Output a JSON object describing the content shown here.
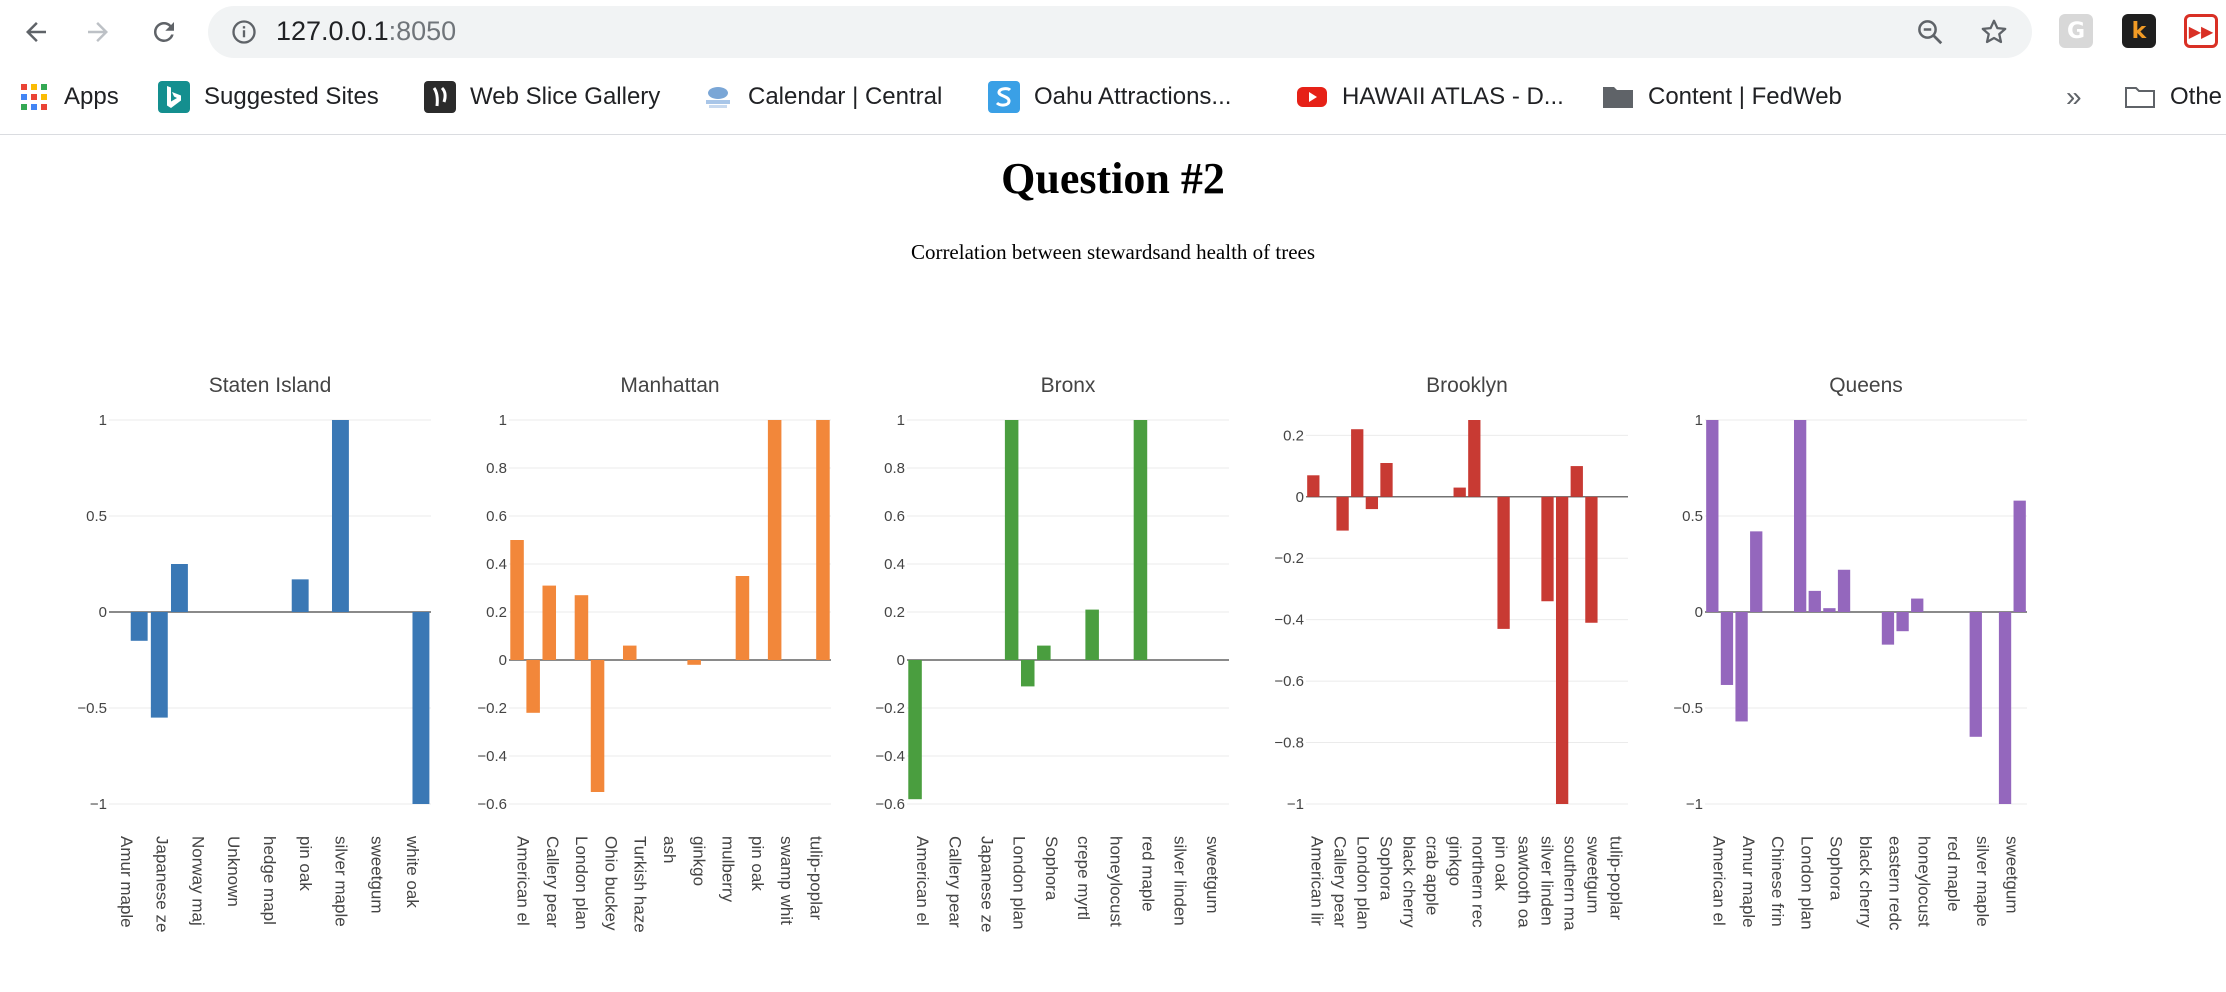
{
  "browser": {
    "url_host": "127.0.0.1",
    "url_port": ":8050"
  },
  "bookmarks": [
    {
      "label": "Apps",
      "icon": "apps-grid-icon"
    },
    {
      "label": "Suggested Sites",
      "icon": "bing-icon"
    },
    {
      "label": "Web Slice Gallery",
      "icon": "web-slice-icon"
    },
    {
      "label": "Calendar | Central",
      "icon": "calendar-logo-icon"
    },
    {
      "label": "Oahu Attractions...",
      "icon": "s-logo-icon"
    },
    {
      "label": "HAWAII ATLAS - D...",
      "icon": "youtube-icon"
    },
    {
      "label": "Content | FedWeb",
      "icon": "folder-icon"
    },
    {
      "label": "Othe",
      "icon": "folder-icon"
    }
  ],
  "page": {
    "title": "Question #2",
    "subtitle": "Correlation between stewardsand health of trees"
  },
  "colors": {
    "staten_island": "#3a78b5",
    "manhattan": "#f2873a",
    "bronx": "#4a9e3f",
    "brooklyn": "#c83a33",
    "queens": "#9467bd"
  },
  "chart_data": [
    {
      "type": "bar",
      "title": "Staten Island",
      "color": "#3a78b5",
      "categories": [
        "Amur maple",
        "Japanese ze",
        "Norway maple",
        "Unknown",
        "hedge maple",
        "pin oak",
        "silver maple",
        "sweetgum",
        "white oak"
      ],
      "tick_labels": [
        "Amur maple",
        "Japanese ze",
        "Norway maj",
        "Unknown",
        "hedge mapl",
        "pin oak",
        "silver maple",
        "sweetgum",
        "white oak"
      ],
      "values": [
        -0.15,
        -0.55,
        0.25,
        0,
        0,
        0.17,
        1,
        0,
        -1
      ],
      "ylim": [
        -1,
        1
      ],
      "yticks": [
        1,
        0.5,
        0,
        -0.5,
        -1
      ],
      "ytick_labels": [
        "1",
        "0.5",
        "0",
        "−0.5",
        "−1"
      ],
      "bar_slots": [
        [
          null,
          -0.15
        ],
        [
          -0.55,
          0.25
        ],
        [
          null,
          null
        ],
        [
          null,
          null
        ],
        [
          null,
          0.17
        ],
        [
          null,
          1
        ],
        [
          null,
          null
        ],
        [
          null,
          -1
        ]
      ]
    },
    {
      "type": "bar",
      "title": "Manhattan",
      "color": "#f2873a",
      "categories": [
        "American elm",
        "Callery pear",
        "London planetree",
        "Ohio buckeye",
        "Turkish hazelnut",
        "ash",
        "ginkgo",
        "mulberry",
        "pin oak",
        "swamp white oak",
        "tulip-poplar"
      ],
      "tick_labels": [
        "American el",
        "Callery pear",
        "London plan",
        "Ohio buckey",
        "Turkish haze",
        "ash",
        "ginkgo",
        "mulberry",
        "pin oak",
        "swamp whit",
        "tulip-poplar"
      ],
      "values": [
        0.5,
        -0.22,
        0.31,
        0.27,
        -0.55,
        0.06,
        0,
        -0.02,
        0,
        0.35,
        1,
        1
      ],
      "ylim": [
        -0.6,
        1
      ],
      "yticks": [
        1,
        0.8,
        0.6,
        0.4,
        0.2,
        0,
        -0.2,
        -0.4,
        -0.6
      ],
      "ytick_labels": [
        "1",
        "0.8",
        "0.6",
        "0.4",
        "0.2",
        "0",
        "−0.2",
        "−0.4",
        "−0.6"
      ],
      "bar_slots": [
        [
          0.5,
          -0.22
        ],
        [
          0.31,
          null
        ],
        [
          0.27,
          -0.55
        ],
        [
          null,
          0.06
        ],
        [
          null,
          null
        ],
        [
          null,
          -0.02
        ],
        [
          null,
          null
        ],
        [
          0.35,
          null
        ],
        [
          1,
          null
        ],
        [
          null,
          1
        ]
      ]
    },
    {
      "type": "bar",
      "title": "Bronx",
      "color": "#4a9e3f",
      "categories": [
        "American elm",
        "Callery pear",
        "Japanese zelkova",
        "London planetree",
        "Sophora",
        "crepe myrtle",
        "honeylocust",
        "red maple",
        "silver linden",
        "sweetgum"
      ],
      "tick_labels": [
        "American el",
        "Callery pear",
        "Japanese ze",
        "London plan",
        "Sophora",
        "crepe myrtl",
        "honeylocust",
        "red maple",
        "silver linden",
        "sweetgum"
      ],
      "values": [
        -0.58,
        0,
        0,
        1,
        -0.11,
        0.06,
        0.21,
        1,
        0,
        0
      ],
      "ylim": [
        -0.6,
        1
      ],
      "yticks": [
        1,
        0.8,
        0.6,
        0.4,
        0.2,
        0,
        -0.2,
        -0.4,
        -0.6
      ],
      "ytick_labels": [
        "1",
        "0.8",
        "0.6",
        "0.4",
        "0.2",
        "0",
        "−0.2",
        "−0.4",
        "−0.6"
      ],
      "bar_slots": [
        [
          -0.58,
          null
        ],
        [
          null,
          null
        ],
        [
          null,
          null
        ],
        [
          1,
          -0.11
        ],
        [
          0.06,
          null
        ],
        [
          null,
          0.21
        ],
        [
          null,
          null
        ],
        [
          1,
          null
        ],
        [
          null,
          null
        ],
        [
          null,
          null
        ]
      ]
    },
    {
      "type": "bar",
      "title": "Brooklyn",
      "color": "#c83a33",
      "categories": [
        "American linden",
        "Callery pear",
        "London planetree",
        "Sophora",
        "black cherry",
        "crab apple",
        "ginkgo",
        "northern red oak",
        "pin oak",
        "sawtooth oak",
        "silver linden",
        "southern magnolia",
        "sweetgum",
        "tulip-poplar"
      ],
      "tick_labels": [
        "American lir",
        "Callery pear",
        "London plan",
        "Sophora",
        "black cherry",
        "crab apple",
        "ginkgo",
        "northern rec",
        "pin oak",
        "sawtooth oa",
        "silver linden",
        "southern ma",
        "sweetgum",
        "tulip-poplar"
      ],
      "values": [
        0.07,
        -0.11,
        0.22,
        -0.04,
        0.11,
        0.03,
        0.25,
        -0.43,
        -0.34,
        -1,
        0.1,
        -0.41
      ],
      "ylim": [
        -1,
        0.25
      ],
      "yticks": [
        0.2,
        0,
        -0.2,
        -0.4,
        -0.6,
        -0.8,
        -1
      ],
      "ytick_labels": [
        "0.2",
        "0",
        "−0.2",
        "−0.4",
        "−0.6",
        "−0.8",
        "−1"
      ],
      "bar_slots": [
        [
          0.07,
          null
        ],
        [
          -0.11,
          0.22
        ],
        [
          -0.04,
          0.11
        ],
        [
          null,
          null
        ],
        [
          null,
          null
        ],
        [
          0.03,
          0.25
        ],
        [
          null,
          -0.43
        ],
        [
          null,
          null
        ],
        [
          -0.34,
          -1
        ],
        [
          0.1,
          -0.41
        ],
        [
          null,
          null
        ]
      ]
    },
    {
      "type": "bar",
      "title": "Queens",
      "color": "#9467bd",
      "categories": [
        "American elm",
        "Amur maple",
        "Chinese fringetree",
        "London planetree",
        "Sophora",
        "black cherry",
        "eastern redcedar",
        "honeylocust",
        "red maple",
        "silver maple",
        "sweetgum"
      ],
      "tick_labels": [
        "American el",
        "Amur maple",
        "Chinese frin",
        "London plan",
        "Sophora",
        "black cherry",
        "eastern redc",
        "honeylocust",
        "red maple",
        "silver maple",
        "sweetgum"
      ],
      "values": [
        1,
        -0.38,
        -0.57,
        0.42,
        1,
        0.11,
        0.02,
        0.22,
        -0.17,
        -0.1,
        0.07,
        -0.65,
        -1,
        0.58
      ],
      "ylim": [
        -1,
        1
      ],
      "yticks": [
        1,
        0.5,
        0,
        -0.5,
        -1
      ],
      "ytick_labels": [
        "1",
        "0.5",
        "0",
        "−0.5",
        "−1"
      ],
      "bar_slots": [
        [
          1,
          -0.38
        ],
        [
          -0.57,
          0.42
        ],
        [
          null,
          null
        ],
        [
          1,
          0.11
        ],
        [
          0.02,
          0.22
        ],
        [
          null,
          null
        ],
        [
          -0.17,
          -0.1
        ],
        [
          0.07,
          null
        ],
        [
          null,
          null
        ],
        [
          -0.65,
          null
        ],
        [
          -1,
          0.58
        ]
      ]
    }
  ]
}
